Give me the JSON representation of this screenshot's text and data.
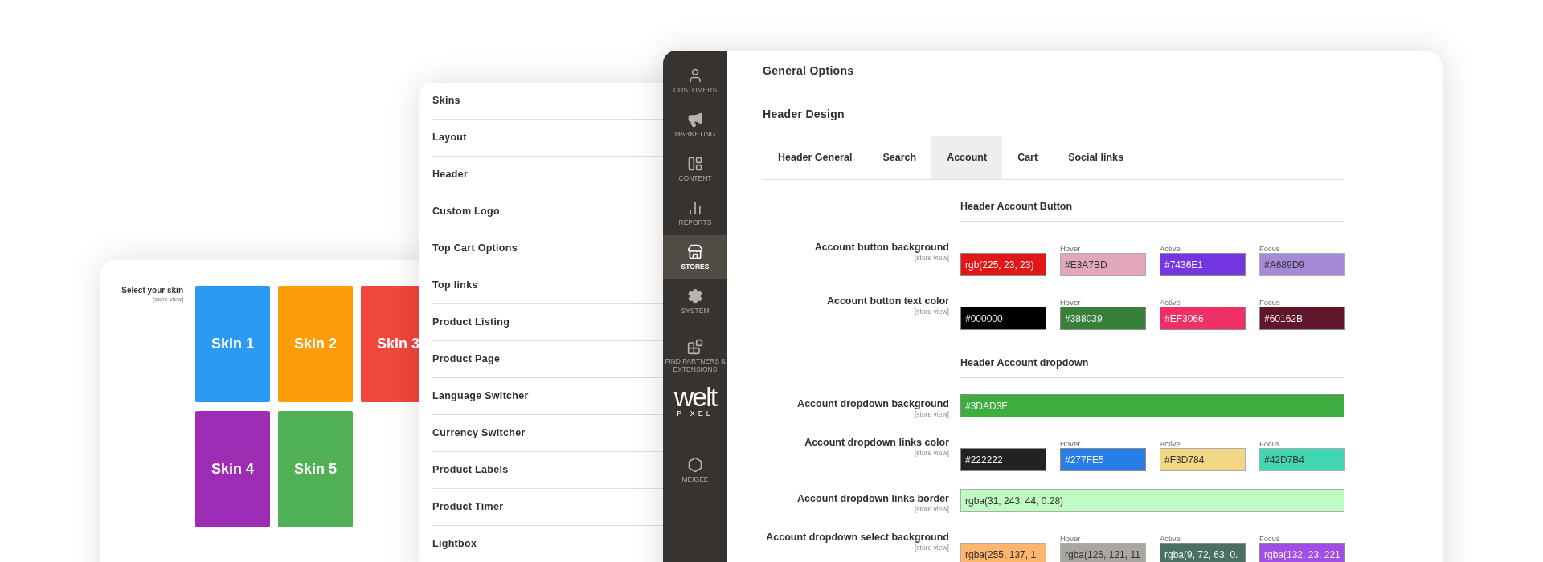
{
  "skin_panel": {
    "label": "Select your skin",
    "scope": "[store view]",
    "skins": [
      {
        "label": "Skin 1",
        "color": "#2a9af2"
      },
      {
        "label": "Skin 2",
        "color": "#ff9c0a"
      },
      {
        "label": "Skin 3",
        "color": "#f0473b"
      },
      {
        "label": "Skin 4",
        "color": "#9e2db5"
      },
      {
        "label": "Skin 5",
        "color": "#50b055"
      }
    ]
  },
  "settings_menu": {
    "items": [
      "Skins",
      "Layout",
      "Header",
      "Custom Logo",
      "Top Cart Options",
      "Top links",
      "Product Listing",
      "Product Page",
      "Language Switcher",
      "Currency Switcher",
      "Product Labels",
      "Product Timer",
      "Lightbox"
    ]
  },
  "admin_sidebar": {
    "primary": [
      {
        "label": "CUSTOMERS",
        "selected": false
      },
      {
        "label": "MARKETING",
        "selected": false
      },
      {
        "label": "CONTENT",
        "selected": false
      },
      {
        "label": "REPORTS",
        "selected": false
      },
      {
        "label": "STORES",
        "selected": true
      },
      {
        "label": "SYSTEM",
        "selected": false
      }
    ],
    "secondary": [
      {
        "kind": "nav",
        "label": "FIND PARTNERS & EXTENSIONS"
      },
      {
        "kind": "logo",
        "text": "welt",
        "subtext": "PIXEL"
      },
      {
        "kind": "nav",
        "label": "MEIGEE"
      }
    ]
  },
  "main": {
    "section_title": "General Options",
    "group_title": "Header Design",
    "tabs": [
      {
        "label": "Header General",
        "selected": false
      },
      {
        "label": "Search",
        "selected": false
      },
      {
        "label": "Account",
        "selected": true
      },
      {
        "label": "Cart",
        "selected": false
      },
      {
        "label": "Social links",
        "selected": false
      }
    ],
    "sections": [
      {
        "title": "Header Account Button",
        "fields": [
          {
            "label": "Account button background",
            "scope": "[store view]",
            "kind": "states",
            "swatches": [
              {
                "value": "rgb(225, 23, 23)",
                "color": "#e11717"
              },
              {
                "caption": "Hover",
                "value": "#E3A7BD",
                "color": "#e3a7bd"
              },
              {
                "caption": "Active",
                "value": "#7436E1",
                "color": "#7436e1"
              },
              {
                "caption": "Focus",
                "value": "#A689D9",
                "color": "#a689d9"
              }
            ]
          },
          {
            "label": "Account button text color",
            "scope": "[store view]",
            "kind": "states",
            "swatches": [
              {
                "value": "#000000",
                "color": "#000000"
              },
              {
                "caption": "Hover",
                "value": "#388039",
                "color": "#388039"
              },
              {
                "caption": "Active",
                "value": "#EF3066",
                "color": "#ef3066"
              },
              {
                "caption": "Focus",
                "value": "#60162B",
                "color": "#60162b"
              }
            ]
          }
        ]
      },
      {
        "title": "Header Account dropdown",
        "fields": [
          {
            "label": "Account dropdown background",
            "scope": "[store view]",
            "kind": "full",
            "swatches": [
              {
                "value": "#3DAD3F",
                "color": "#3dad3f"
              }
            ]
          },
          {
            "label": "Account dropdown links color",
            "scope": "[store view]",
            "kind": "states",
            "swatches": [
              {
                "value": "#222222",
                "color": "#222222"
              },
              {
                "caption": "Hover",
                "value": "#277FE5",
                "color": "#277fe5"
              },
              {
                "caption": "Active",
                "value": "#F3D784",
                "color": "#f3d784"
              },
              {
                "caption": "Focus",
                "value": "#42D7B4",
                "color": "#42d7b4"
              }
            ]
          },
          {
            "label": "Account dropdown links border",
            "scope": "[store view]",
            "kind": "full",
            "swatches": [
              {
                "value": "rgba(31, 243, 44, 0.28)",
                "color": "#c0fbc3"
              }
            ]
          },
          {
            "label": "Account dropdown select background",
            "scope": "[store view]",
            "kind": "states",
            "swatches": [
              {
                "value": "rgba(255, 137, 1",
                "color": "#ffb66c"
              },
              {
                "caption": "Hover",
                "value": "rgba(126, 121, 11",
                "color": "#aaa6a2"
              },
              {
                "caption": "Active",
                "value": "rgba(9, 72, 63, 0.",
                "color": "#4a7066"
              },
              {
                "caption": "Focus",
                "value": "rgba(132, 23, 221",
                "color": "#a24de6"
              }
            ]
          }
        ]
      }
    ]
  }
}
